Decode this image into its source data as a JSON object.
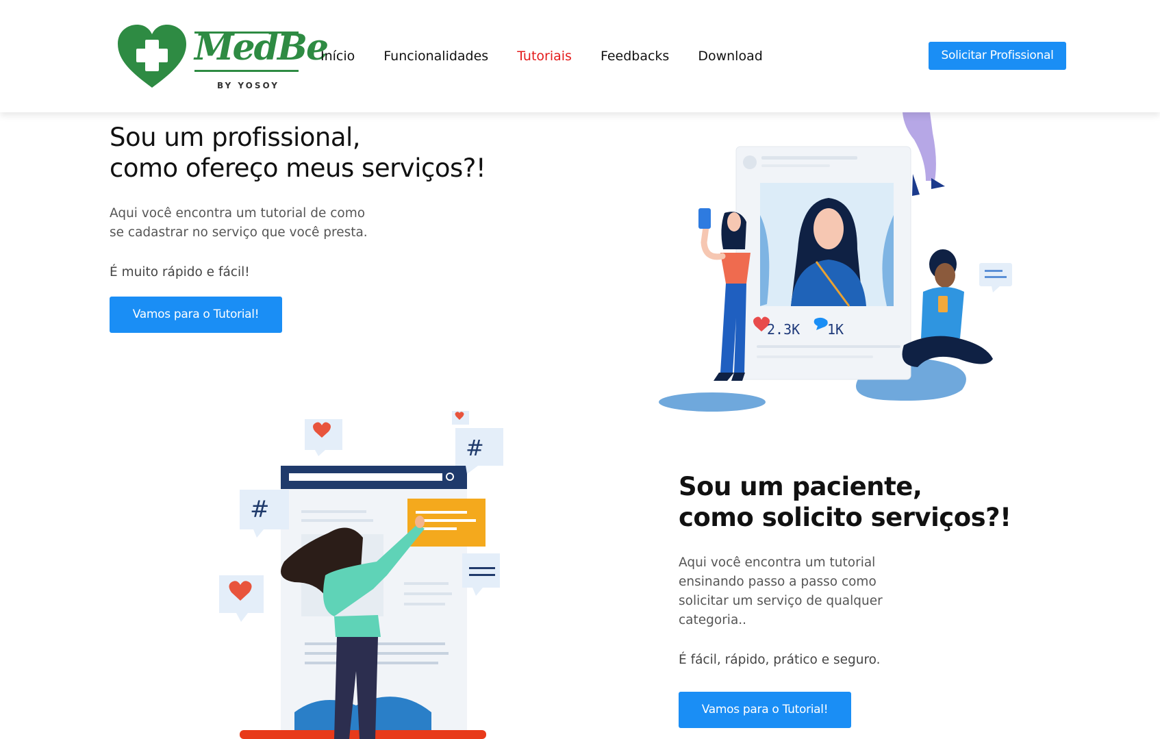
{
  "header": {
    "logo": {
      "brand": "MedBe",
      "byline": "BY YOSOY"
    },
    "nav": [
      {
        "label": "Início"
      },
      {
        "label": "Funcionalidades"
      },
      {
        "label": "Tutoriais",
        "active": true
      },
      {
        "label": "Feedbacks"
      },
      {
        "label": "Download"
      }
    ],
    "cta_label": "Solicitar Profissional"
  },
  "section_professional": {
    "title_line1": "Sou um profissional,",
    "title_line2": "como ofereço meus serviços?!",
    "desc_line1": "Aqui você encontra um tutorial de como",
    "desc_line2": "se cadastrar no serviço que você presta.",
    "note": "É muito rápido e fácil!",
    "button_label": "Vamos para o Tutorial!",
    "illustration": {
      "likes": "2.3K",
      "comments": "1K"
    }
  },
  "section_patient": {
    "title_line1": "Sou um paciente,",
    "title_line2": "como solicito serviços?!",
    "desc_line1": "Aqui você encontra um tutorial",
    "desc_line2": "ensinando passo a passo como",
    "desc_line3": "solicitar um serviço de qualquer",
    "desc_line4": "categoria..",
    "note": "É fácil, rápido, prático e seguro.",
    "button_label": "Vamos para o Tutorial!"
  },
  "colors": {
    "brand_green": "#2e8b43",
    "accent_blue": "#1a8ef5",
    "active_nav_red": "#e41b1b"
  }
}
